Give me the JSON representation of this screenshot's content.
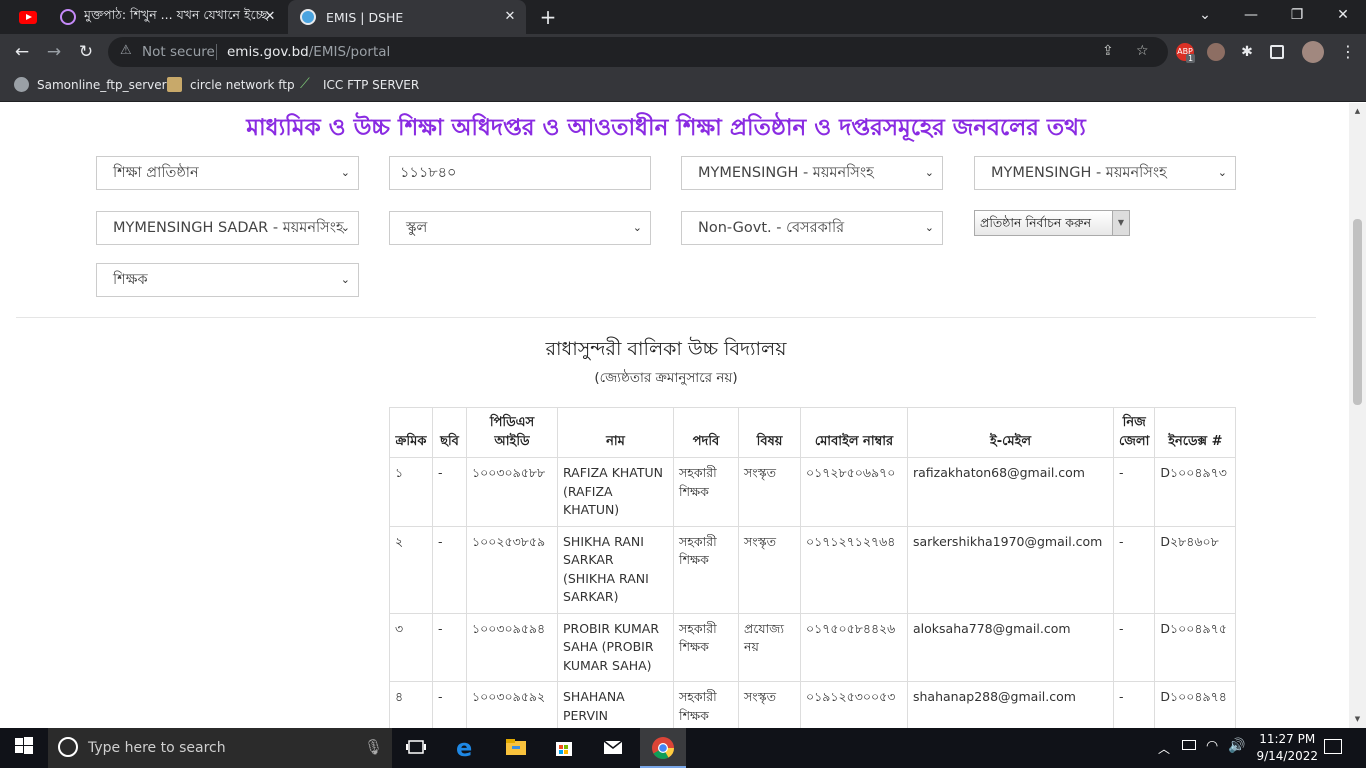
{
  "browser": {
    "tabs": [
      {
        "title": "",
        "icon": "youtube-icon"
      },
      {
        "title": "মুক্তপাঠ: শিখুন ... যখন যেখানে ইচ্ছে",
        "icon": "muktopaath-icon"
      },
      {
        "title": "EMIS | DSHE",
        "icon": "emis-icon",
        "active": true
      }
    ],
    "address": {
      "security": "Not secure",
      "host": "emis.gov.bd",
      "path": "/EMIS/portal"
    },
    "bookmarks": [
      "Samonline_ftp_server",
      "circle network ftp",
      "ICC FTP SERVER"
    ],
    "extension_badge": "1"
  },
  "page": {
    "title": "মাধ্যমিক ও উচ্চ শিক্ষা অধিদপ্তর ও আওতাধীন শিক্ষা প্রতিষ্ঠান ও দপ্তরসমূহের জনবলের তথ্য",
    "filters": {
      "category": "শিক্ষা প্রাতিষ্ঠান",
      "eiin": "১১১৮৪০",
      "division": "MYMENSINGH - ময়মনসিংহ",
      "district": "MYMENSINGH - ময়মনসিংহ",
      "upazila": "MYMENSINGH SADAR - ময়মনসিংহ",
      "institute_type": "স্কুল",
      "management": "Non-Govt. - বেসরকারি",
      "institute_select": "প্রতিষ্ঠান নির্বাচন করুন",
      "staff_type": "শিক্ষক"
    },
    "school_name": "রাধাসুন্দরী বালিকা উচ্চ বিদ্যালয়",
    "school_note": "(জ্যেষ্ঠতার ক্রমানুসারে নয়)",
    "table": {
      "headers": {
        "serial": "ক্রমিক",
        "photo": "ছবি",
        "pds_id": "পিডিএস আইডি",
        "name": "নাম",
        "designation": "পদবি",
        "subject": "বিষয়",
        "mobile": "মোবাইল নাম্বার",
        "email": "ই-মেইল",
        "home_district": "নিজ জেলা",
        "index": "ইনডেক্স #"
      },
      "rows": [
        {
          "serial": "১",
          "photo": "-",
          "pds_id": "১০০৩০৯৫৮৮",
          "name": "RAFIZA KHATUN (RAFIZA KHATUN)",
          "designation": "সহকারী শিক্ষক",
          "subject": "সংস্কৃত",
          "mobile": "০১৭২৮৫০৬৯৭০",
          "email": "rafizakhaton68@gmail.com",
          "home_district": "-",
          "index": "D১০০৪৯৭৩"
        },
        {
          "serial": "২",
          "photo": "-",
          "pds_id": "১০০২৫৩৮৫৯",
          "name": "SHIKHA RANI SARKAR (SHIKHA RANI SARKAR)",
          "designation": "সহকারী শিক্ষক",
          "subject": "সংস্কৃত",
          "mobile": "০১৭১২৭১২৭৬৪",
          "email": "sarkershikha1970@gmail.com",
          "home_district": "-",
          "index": "D২৮৪৬০৮"
        },
        {
          "serial": "৩",
          "photo": "-",
          "pds_id": "১০০৩০৯৫৯৪",
          "name": "PROBIR KUMAR SAHA (PROBIR KUMAR SAHA)",
          "designation": "সহকারী শিক্ষক",
          "subject": "প্রযোজ্য নয়",
          "mobile": "০১৭৫০৫৮৪৪২৬",
          "email": "aloksaha778@gmail.com",
          "home_district": "-",
          "index": "D১০০৪৯৭৫"
        },
        {
          "serial": "৪",
          "photo": "-",
          "pds_id": "১০০৩০৯৫৯২",
          "name": "SHAHANA PERVIN (SHAHANA PERVIN)",
          "designation": "সহকারী শিক্ষক",
          "subject": "সংস্কৃত",
          "mobile": "০১৯১২৫৩০০৫৩",
          "email": "shahanap288@gmail.com",
          "home_district": "-",
          "index": "D১০০৪৯৭৪"
        }
      ]
    }
  },
  "taskbar": {
    "search_placeholder": "Type here to search",
    "time": "11:27 PM",
    "date": "9/14/2022"
  }
}
